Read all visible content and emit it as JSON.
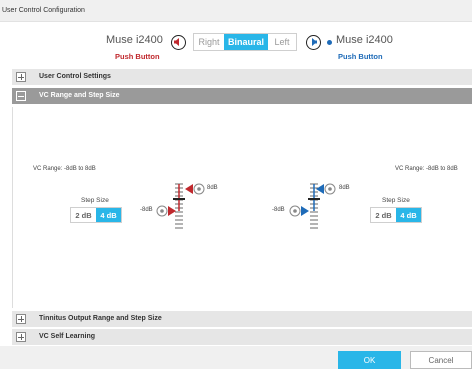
{
  "window": {
    "title": "User Control Configuration"
  },
  "devices": {
    "left": {
      "name": "Muse i2400",
      "sub": "Push Button",
      "color": "#c0282d"
    },
    "right": {
      "name": "Muse i2400",
      "sub": "Push Button",
      "color": "#1e6bb8"
    }
  },
  "sides": {
    "options": [
      "Right",
      "Binaural",
      "Left"
    ],
    "selected": "Binaural"
  },
  "sections": [
    {
      "label": "User Control Settings",
      "expanded": false
    },
    {
      "label": "VC Range and Step Size",
      "expanded": true
    },
    {
      "label": "Tinnitus Output Range and Step Size",
      "expanded": false
    },
    {
      "label": "VC Self Learning",
      "expanded": false
    }
  ],
  "vc": {
    "left": {
      "range": "VC Range: -8dB to 8dB",
      "step_title": "Step Size",
      "steps": [
        "2 dB",
        "4 dB"
      ],
      "selected_step": "4 dB",
      "max": "8dB",
      "min": "-8dB"
    },
    "right": {
      "range": "VC Range: -8dB to 8dB",
      "step_title": "Step Size",
      "steps": [
        "2 dB",
        "4 dB"
      ],
      "selected_step": "4 dB",
      "max": "8dB",
      "min": "-8dB"
    }
  },
  "footer": {
    "ok": "OK",
    "cancel": "Cancel"
  },
  "colors": {
    "accent": "#29b6e8",
    "left_ear": "#c0282d",
    "right_ear": "#1e6bb8"
  },
  "icons": [
    "speaker-left-icon",
    "speaker-right-icon",
    "plus-icon",
    "minus-icon",
    "slider-handle-icon"
  ]
}
